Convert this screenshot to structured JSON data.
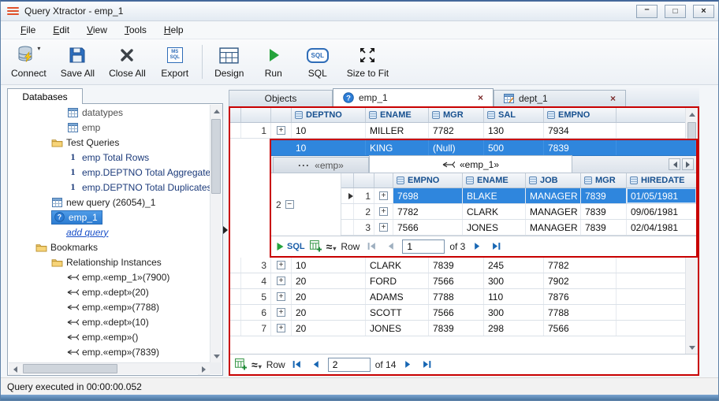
{
  "window": {
    "title": "Query Xtractor - emp_1",
    "status": "Query executed in 00:00:00.052"
  },
  "accents": {
    "annotation_red": "#c80000",
    "selection_blue": "#2f86dd",
    "header_navy": "#17508f"
  },
  "menubar": {
    "items": [
      {
        "label": "File"
      },
      {
        "label": "Edit"
      },
      {
        "label": "View"
      },
      {
        "label": "Tools"
      },
      {
        "label": "Help"
      }
    ]
  },
  "toolbar": {
    "connect": "Connect",
    "save_all": "Save All",
    "close_all": "Close All",
    "export": "Export",
    "design": "Design",
    "run": "Run",
    "sql": "SQL",
    "size_to_fit": "Size to Fit",
    "export_icon_top": "MS",
    "export_icon_bottom": "SQL",
    "sql_icon_text": "SQL"
  },
  "sidebar": {
    "tab_label": "Databases",
    "tree": [
      {
        "label": "datatypes",
        "icon": "table"
      },
      {
        "label": "emp",
        "icon": "table"
      },
      {
        "label": "Test Queries",
        "icon": "folder"
      },
      {
        "label": "emp Total Rows",
        "icon": "total"
      },
      {
        "label": "emp.DEPTNO Total Aggregates",
        "icon": "total"
      },
      {
        "label": "emp.DEPTNO Total Duplicates",
        "icon": "total"
      },
      {
        "label": "new query (26054)_1",
        "icon": "table"
      },
      {
        "label": "emp_1",
        "icon": "help"
      },
      {
        "label": "add query",
        "icon": "none"
      },
      {
        "label": "Bookmarks",
        "icon": "folder"
      },
      {
        "label": "Relationship Instances",
        "icon": "folder"
      },
      {
        "label": "emp.«emp_1»(7900)",
        "icon": "relation"
      },
      {
        "label": "emp.«dept»(20)",
        "icon": "relation"
      },
      {
        "label": "emp.«emp»(7788)",
        "icon": "relation"
      },
      {
        "label": "emp.«dept»(10)",
        "icon": "relation"
      },
      {
        "label": "emp.«emp»()",
        "icon": "relation"
      },
      {
        "label": "emp.«emp»(7839)",
        "icon": "relation"
      }
    ]
  },
  "tabs": [
    {
      "label": "Objects"
    },
    {
      "label": "emp_1"
    },
    {
      "label": "dept_1"
    }
  ],
  "grid": {
    "columns": [
      "DEPTNO",
      "ENAME",
      "MGR",
      "SAL",
      "EMPNO"
    ],
    "rows_top": [
      {
        "num": "1",
        "cells": [
          "10",
          "MILLER",
          "7782",
          "130",
          "7934"
        ]
      }
    ],
    "master_row": {
      "cells": [
        "10",
        "KING",
        "(Null)",
        "500",
        "7839"
      ]
    },
    "expanded_row_num": "2",
    "rows_bottom": [
      {
        "num": "3",
        "cells": [
          "10",
          "CLARK",
          "7839",
          "245",
          "7782"
        ]
      },
      {
        "num": "4",
        "cells": [
          "20",
          "FORD",
          "7566",
          "300",
          "7902"
        ]
      },
      {
        "num": "5",
        "cells": [
          "20",
          "ADAMS",
          "7788",
          "110",
          "7876"
        ]
      },
      {
        "num": "6",
        "cells": [
          "20",
          "SCOTT",
          "7566",
          "300",
          "7788"
        ]
      },
      {
        "num": "7",
        "cells": [
          "20",
          "JONES",
          "7839",
          "298",
          "7566"
        ]
      }
    ],
    "pager": {
      "row_label": "Row",
      "value": "2",
      "of_label": "of 14"
    }
  },
  "detail": {
    "tabs": [
      {
        "label": "«emp»"
      },
      {
        "label": "«emp_1»"
      }
    ],
    "columns": [
      "EMPNO",
      "ENAME",
      "JOB",
      "MGR",
      "HIREDATE"
    ],
    "rows": [
      {
        "num": "1",
        "cells": [
          "7698",
          "BLAKE",
          "MANAGER",
          "7839",
          "01/05/1981"
        ]
      },
      {
        "num": "2",
        "cells": [
          "7782",
          "CLARK",
          "MANAGER",
          "7839",
          "09/06/1981"
        ]
      },
      {
        "num": "3",
        "cells": [
          "7566",
          "JONES",
          "MANAGER",
          "7839",
          "02/04/1981"
        ]
      }
    ],
    "pager": {
      "sql_label": "SQL",
      "row_label": "Row",
      "value": "1",
      "of_label": "of 3"
    }
  }
}
